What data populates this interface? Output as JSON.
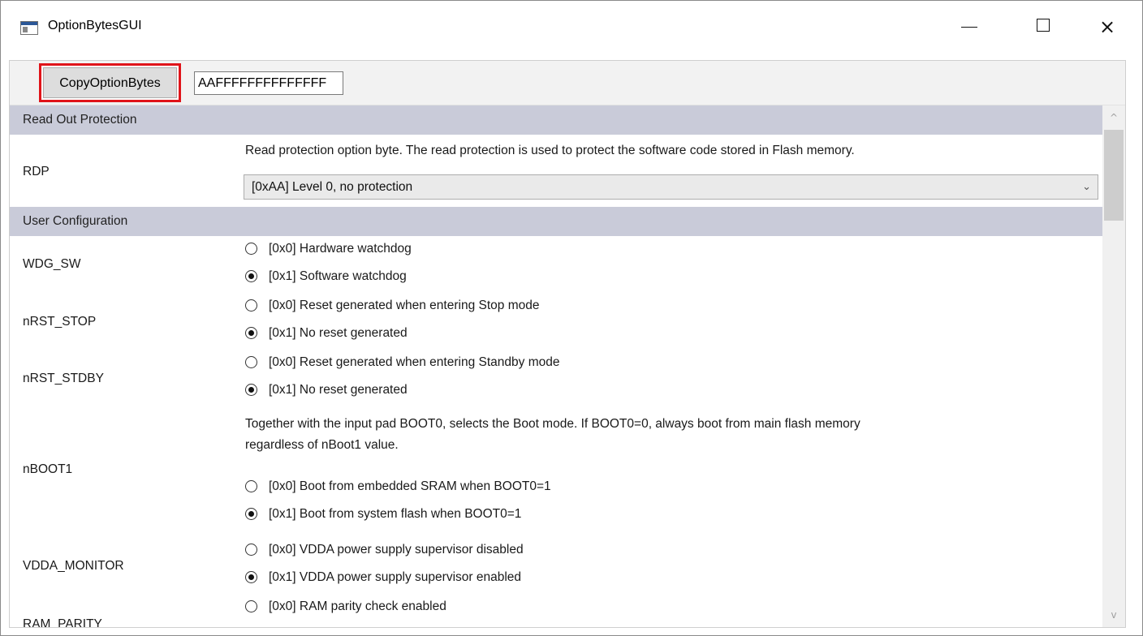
{
  "window": {
    "title": "OptionBytesGUI",
    "minimize_glyph": "minimize-icon",
    "maximize_glyph": "maximize-icon",
    "close_glyph": "×"
  },
  "toolbar": {
    "copy_label": "CopyOptionBytes",
    "hex_value": "AAFFFFFFFFFFFFFF"
  },
  "sections": {
    "read_out": "Read Out Protection",
    "user_config": "User Configuration"
  },
  "rdp": {
    "label": "RDP",
    "description": "Read protection option byte. The read protection is used to protect the software code stored in Flash memory.",
    "selected": "[0xAA] Level 0, no protection"
  },
  "wdg_sw": {
    "label": "WDG_SW",
    "options": [
      "[0x0] Hardware watchdog",
      "[0x1] Software watchdog"
    ],
    "selected_index": 1
  },
  "nrst_stop": {
    "label": "nRST_STOP",
    "options": [
      "[0x0] Reset generated when entering Stop mode",
      "[0x1] No reset generated"
    ],
    "selected_index": 1
  },
  "nrst_stdby": {
    "label": "nRST_STDBY",
    "options": [
      "[0x0] Reset generated when entering Standby mode",
      "[0x1] No reset generated"
    ],
    "selected_index": 1
  },
  "nboot1": {
    "label": "nBOOT1",
    "description_line1": "Together with the input pad BOOT0, selects the Boot mode. If BOOT0=0, always boot from main flash memory",
    "description_line2": "regardless of nBoot1 value.",
    "options": [
      "[0x0] Boot from embedded SRAM when BOOT0=1",
      "[0x1] Boot from system flash when BOOT0=1"
    ],
    "selected_index": 1
  },
  "vdda_monitor": {
    "label": "VDDA_MONITOR",
    "options": [
      "[0x0] VDDA power supply supervisor disabled",
      "[0x1] VDDA power supply supervisor enabled"
    ],
    "selected_index": 1
  },
  "ram_parity": {
    "label": "RAM_PARITY",
    "options": [
      "[0x0] RAM parity check enabled"
    ],
    "selected_index": -1
  },
  "scrollbar": {
    "up_glyph": "^",
    "down_glyph": "v"
  }
}
